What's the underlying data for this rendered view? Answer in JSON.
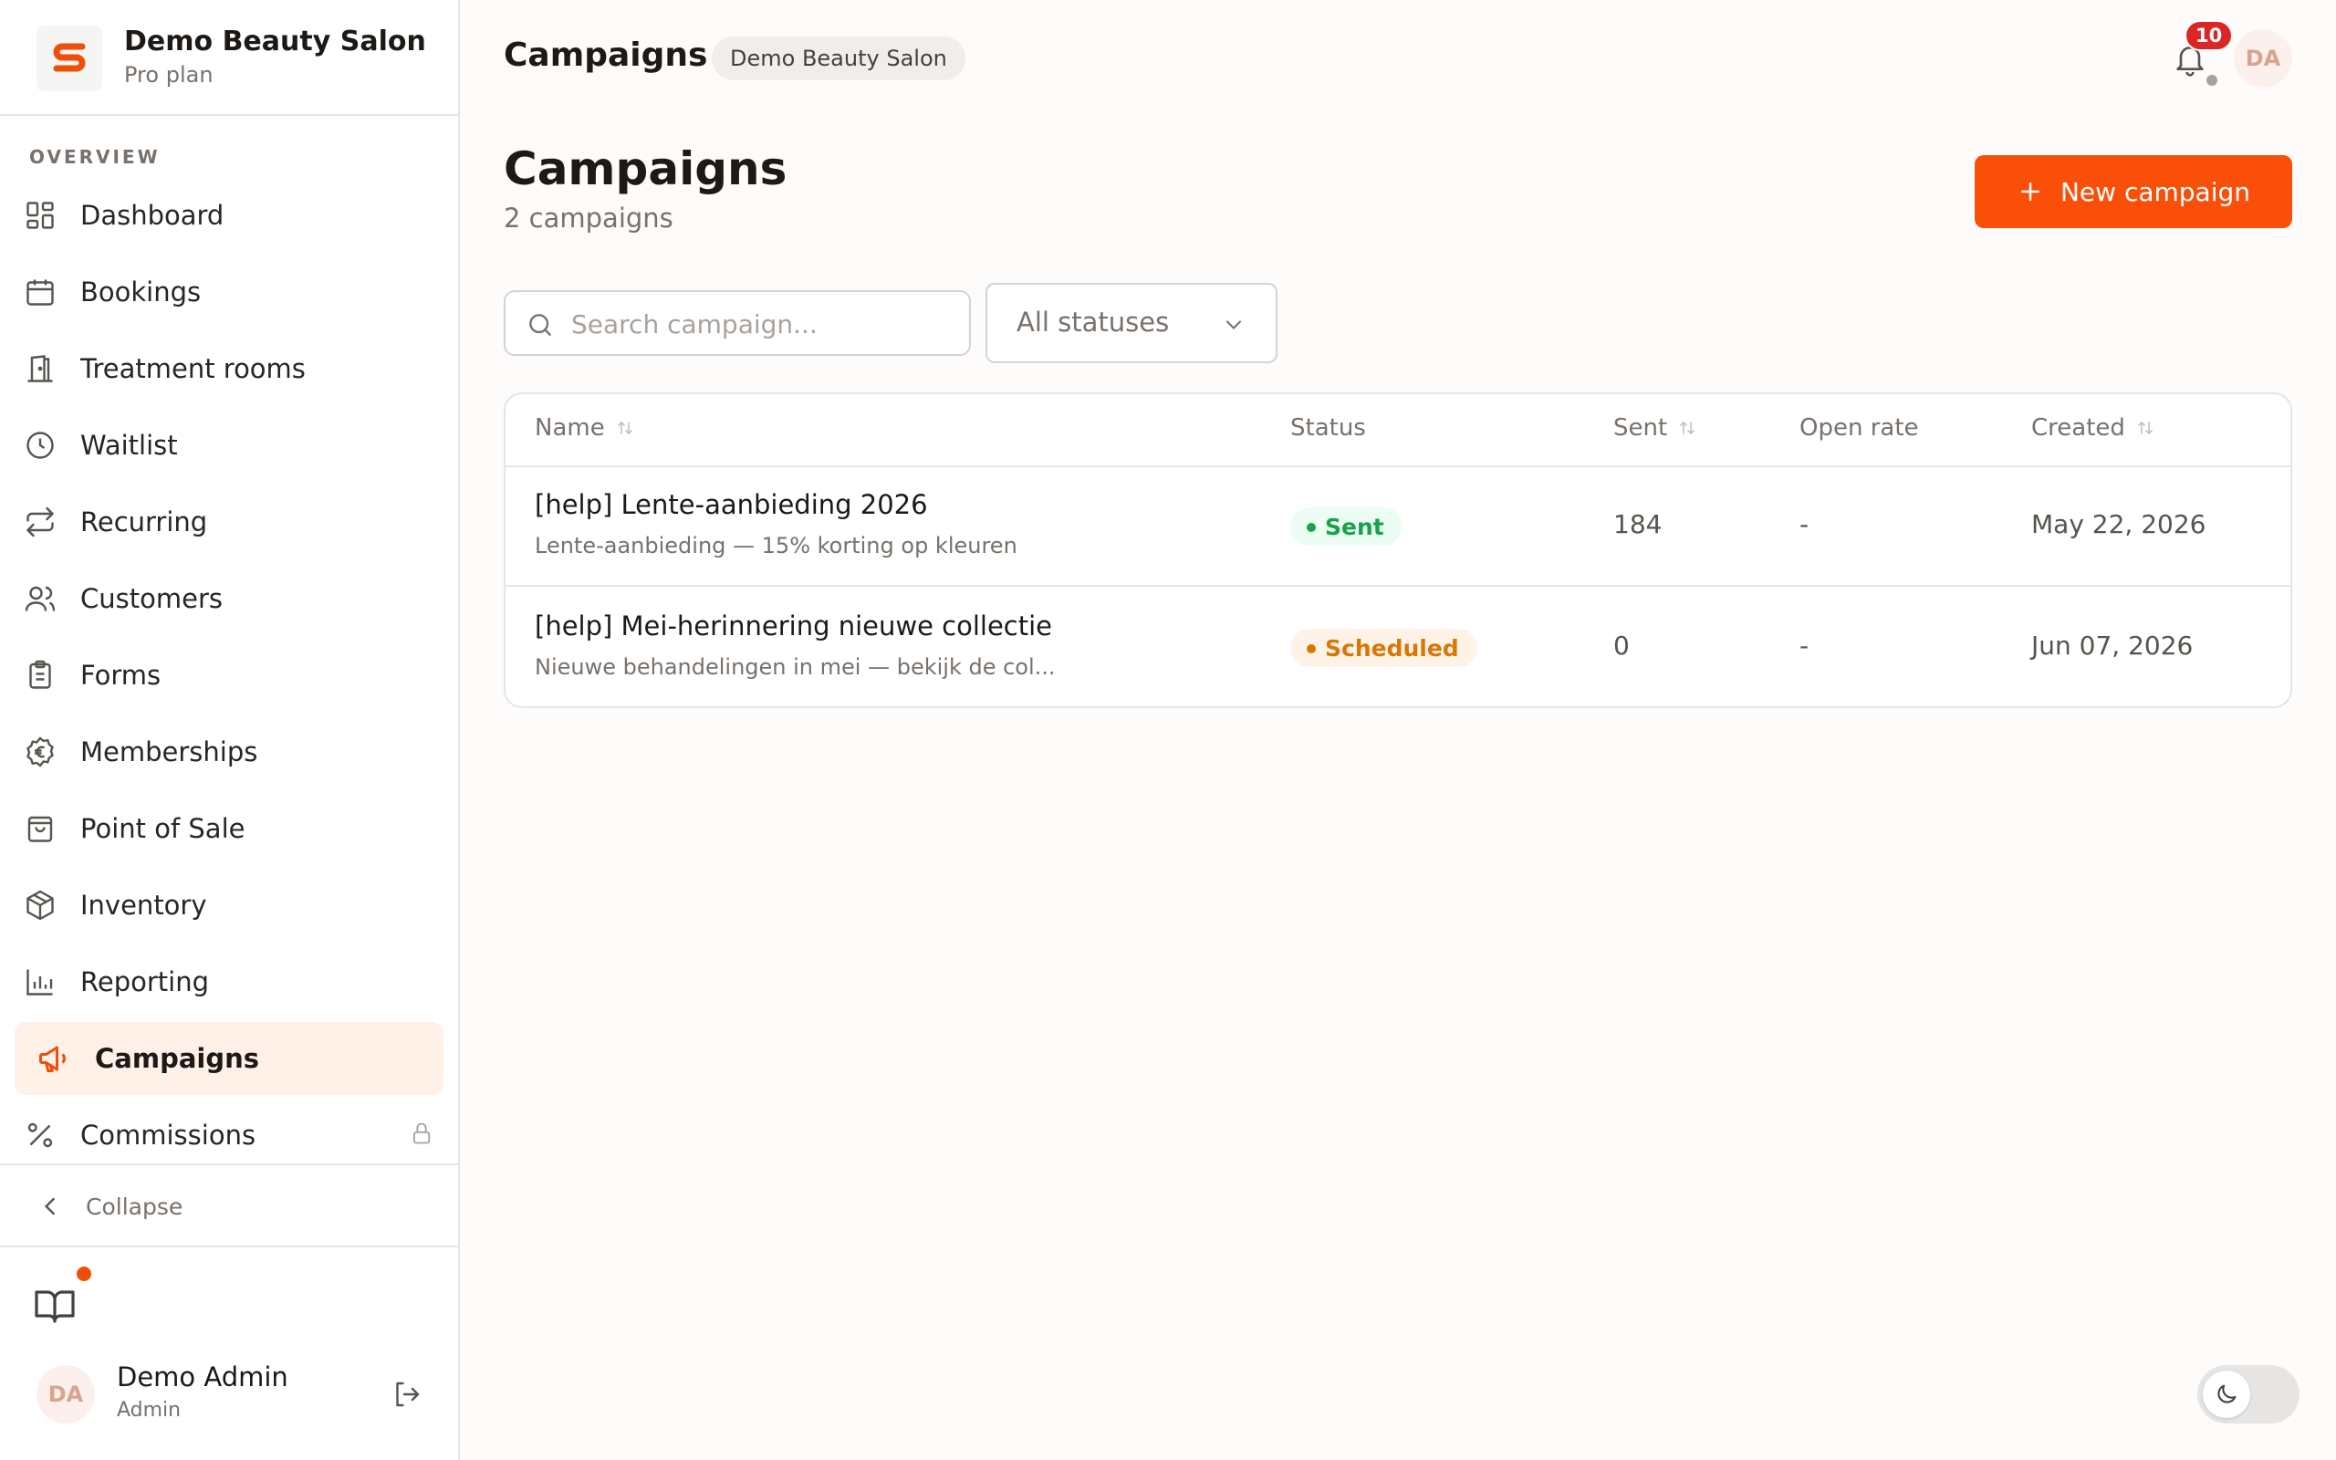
{
  "brand": {
    "name": "Demo Beauty Salon",
    "plan": "Pro plan",
    "logo_letter": "S",
    "accent_color": "#f04f0a"
  },
  "sidebar": {
    "section": "OVERVIEW",
    "items": [
      {
        "label": "Dashboard",
        "icon": "dashboard-icon"
      },
      {
        "label": "Bookings",
        "icon": "calendar-icon"
      },
      {
        "label": "Treatment rooms",
        "icon": "door-icon"
      },
      {
        "label": "Waitlist",
        "icon": "clock-icon"
      },
      {
        "label": "Recurring",
        "icon": "repeat-icon"
      },
      {
        "label": "Customers",
        "icon": "users-icon"
      },
      {
        "label": "Forms",
        "icon": "clipboard-icon"
      },
      {
        "label": "Memberships",
        "icon": "euro-badge-icon"
      },
      {
        "label": "Point of Sale",
        "icon": "shopping-bag-icon"
      },
      {
        "label": "Inventory",
        "icon": "package-icon"
      },
      {
        "label": "Reporting",
        "icon": "bar-chart-icon"
      },
      {
        "label": "Campaigns",
        "icon": "megaphone-icon",
        "active": true
      },
      {
        "label": "Commissions",
        "icon": "percent-icon",
        "locked": true
      }
    ],
    "collapse_label": "Collapse",
    "user": {
      "initials": "DA",
      "name": "Demo Admin",
      "role": "Admin"
    }
  },
  "header": {
    "title": "Campaigns",
    "badge": "Demo Beauty Salon",
    "notification_count": "10",
    "avatar_initials": "DA"
  },
  "page": {
    "title": "Campaigns",
    "subtitle": "2 campaigns",
    "new_button": "New campaign"
  },
  "filters": {
    "search_placeholder": "Search campaign...",
    "search_value": "",
    "status_value": "All statuses"
  },
  "table": {
    "columns": {
      "name": "Name",
      "status": "Status",
      "sent": "Sent",
      "open_rate": "Open rate",
      "created": "Created"
    },
    "rows": [
      {
        "name": "[help] Lente-aanbieding 2026",
        "description": "Lente-aanbieding — 15% korting op kleuren",
        "status": "Sent",
        "sent": "184",
        "open_rate": "-",
        "created": "May 22, 2026"
      },
      {
        "name": "[help] Mei-herinnering nieuwe collectie",
        "description": "Nieuwe behandelingen in mei — bekijk de col...",
        "status": "Scheduled",
        "sent": "0",
        "open_rate": "-",
        "created": "Jun 07, 2026"
      }
    ]
  },
  "colors": {
    "primary_button": "#fa4f09",
    "sent_badge": "#16a34a",
    "scheduled_badge": "#d97706",
    "notification_badge": "#dc2626"
  }
}
